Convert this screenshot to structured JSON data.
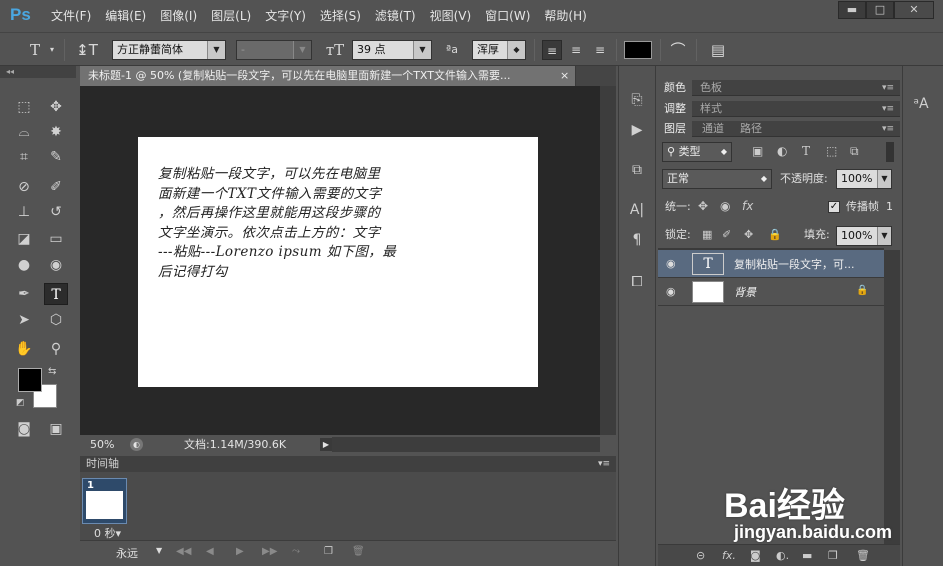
{
  "app": {
    "logo": "Ps"
  },
  "menu": [
    "文件(F)",
    "编辑(E)",
    "图像(I)",
    "图层(L)",
    "文字(Y)",
    "选择(S)",
    "滤镜(T)",
    "视图(V)",
    "窗口(W)",
    "帮助(H)"
  ],
  "window_buttons": {
    "min": "▬",
    "max": "□",
    "close": "✕"
  },
  "options": {
    "tool_icon": "T",
    "font_family": "方正静蕾简体",
    "font_style": "-",
    "font_size": "39 点",
    "aa_icon": "ªa",
    "antialias": "浑厚",
    "color": "#000000"
  },
  "document": {
    "tab_title": "未标题-1 @ 50% (复制粘贴一段文字，可以先在电脑里面新建一个TXT文件输入需要...",
    "close": "×",
    "lines": [
      "复制粘贴一段文字，可以先在电脑里",
      "面新建一个TXT文件输入需要的文字",
      "，然后再操作这里就能用这段步骤的",
      "文字坐演示。依次点击上方的：文字",
      "---粘贴---Lorenzo ipsum 如下图，最",
      "后记得打勾"
    ],
    "zoom": "50%",
    "doc_size": "文档:1.14M/390.6K"
  },
  "timeline": {
    "title": "时间轴",
    "frame_number": "1",
    "frame_delay": "0 秒▾",
    "loop": "永远"
  },
  "panels": {
    "group1": [
      "颜色",
      "色板"
    ],
    "group2": [
      "调整",
      "样式"
    ],
    "group3": [
      "图层",
      "通道",
      "路径"
    ],
    "filter_kind": "类型",
    "blend_mode": "正常",
    "opacity_label": "不透明度:",
    "opacity": "100%",
    "unify_label": "统一:",
    "propagate_label": "传播帧",
    "propagate_value": "1",
    "lock_label": "锁定:",
    "fill_label": "填充:",
    "fill": "100%",
    "layers": [
      {
        "name": "复制粘贴一段文字，可...",
        "type": "text",
        "thumb": "T"
      },
      {
        "name": "背景",
        "type": "image"
      }
    ]
  },
  "watermark": {
    "logo": "Bai经验",
    "url": "jingyan.baidu.com"
  }
}
